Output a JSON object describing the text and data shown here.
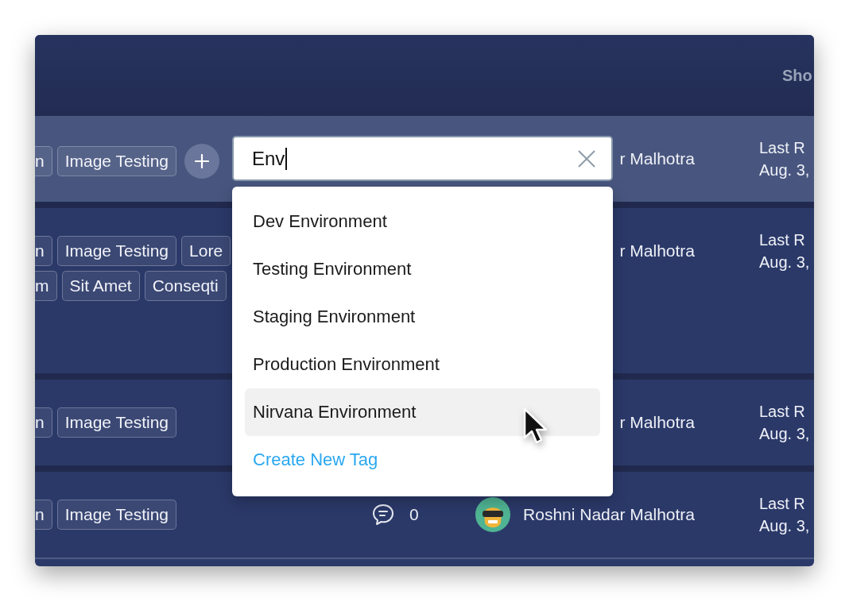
{
  "header": {
    "column_label": "Sho"
  },
  "rows": [
    {
      "selected": true,
      "tag_lines": [
        [
          "n",
          "Image Testing"
        ]
      ],
      "owner": "r Malhotra",
      "last_run": "Last R",
      "date": "Aug. 3,"
    },
    {
      "selected": false,
      "tag_lines": [
        [
          "n",
          "Image Testing",
          "Lore"
        ],
        [
          "m",
          "Sit Amet",
          "Conseqti"
        ]
      ],
      "owner": "r Malhotra",
      "last_run": "Last R",
      "date": "Aug. 3,"
    },
    {
      "selected": false,
      "tag_lines": [
        [
          "n",
          "Image Testing"
        ]
      ],
      "owner": "r Malhotra",
      "last_run": "Last R",
      "date": "Aug. 3,"
    },
    {
      "selected": false,
      "tag_lines": [
        [
          "n",
          "Image Testing"
        ]
      ],
      "comments": "0",
      "owner": "Roshni Nadar Malhotra",
      "last_run": "Last R",
      "date": "Aug. 3,"
    }
  ],
  "tag_search": {
    "value": "Env",
    "focused": true,
    "options": [
      {
        "label": "Dev Environment",
        "highlighted": false
      },
      {
        "label": "Testing Environment",
        "highlighted": false
      },
      {
        "label": "Staging Environment",
        "highlighted": false
      },
      {
        "label": "Production Environment",
        "highlighted": false
      },
      {
        "label": "Nirvana Environment",
        "highlighted": true
      }
    ],
    "create_label": "Create New Tag"
  }
}
